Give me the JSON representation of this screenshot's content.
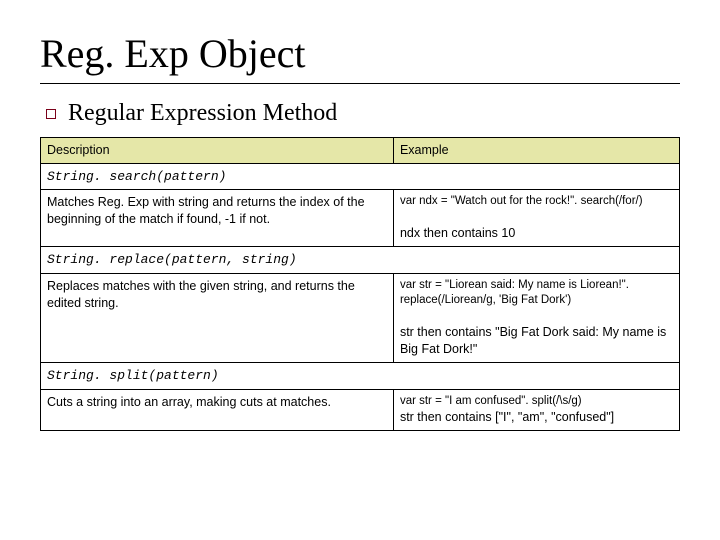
{
  "slide": {
    "title": "Reg. Exp Object",
    "subtitle": "Regular Expression Method"
  },
  "table": {
    "header": {
      "col1": "Description",
      "col2": "Example"
    },
    "rows": {
      "search_method": "String. search(pattern)",
      "search_desc": "Matches Reg. Exp with string and returns the index of the beginning of the match if found, -1 if not.",
      "search_example_code": "var ndx = \"Watch out for the rock!\". search(/for/)",
      "search_example_result": "ndx then contains 10",
      "replace_method": "String. replace(pattern, string)",
      "replace_desc": "Replaces matches with the given string, and returns the edited string.",
      "replace_example_code": "var str = \"Liorean said: My name is Liorean!\". replace(/Liorean/g, 'Big Fat Dork')",
      "replace_example_result": "str then contains \"Big Fat Dork said: My name is Big Fat Dork!\"",
      "split_method": "String. split(pattern)",
      "split_desc": "Cuts a string into an array, making cuts at matches.",
      "split_example_code": "var str = \"I am confused\". split(/\\s/g)",
      "split_example_result": "str then contains [\"I\", \"am\", \"confused\"]"
    }
  }
}
